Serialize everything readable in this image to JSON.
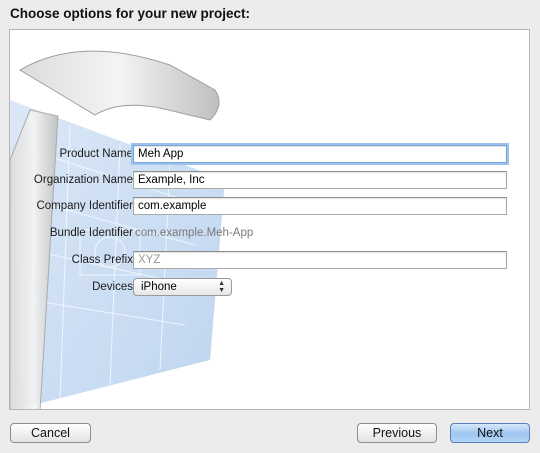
{
  "window": {
    "heading": "Choose options for your new project:"
  },
  "form": {
    "product_name": {
      "label": "Product Name",
      "value": "Meh App"
    },
    "organization_name": {
      "label": "Organization Name",
      "value": "Example, Inc"
    },
    "company_identifier": {
      "label": "Company Identifier",
      "value": "com.example"
    },
    "bundle_identifier": {
      "label": "Bundle Identifier",
      "value": "com.example.Meh-App"
    },
    "class_prefix": {
      "label": "Class Prefix",
      "placeholder": "XYZ"
    },
    "devices": {
      "label": "Devices",
      "selected": "iPhone"
    }
  },
  "buttons": {
    "cancel": "Cancel",
    "previous": "Previous",
    "next": "Next"
  },
  "colors": {
    "primary_button": "#9ec5f0",
    "focus_ring": "#9cc3f0",
    "blueprint": "#b9d3f0"
  },
  "icons": {
    "background": "hammer-blueprint-icon",
    "select_arrows": "updown-arrows-icon"
  }
}
